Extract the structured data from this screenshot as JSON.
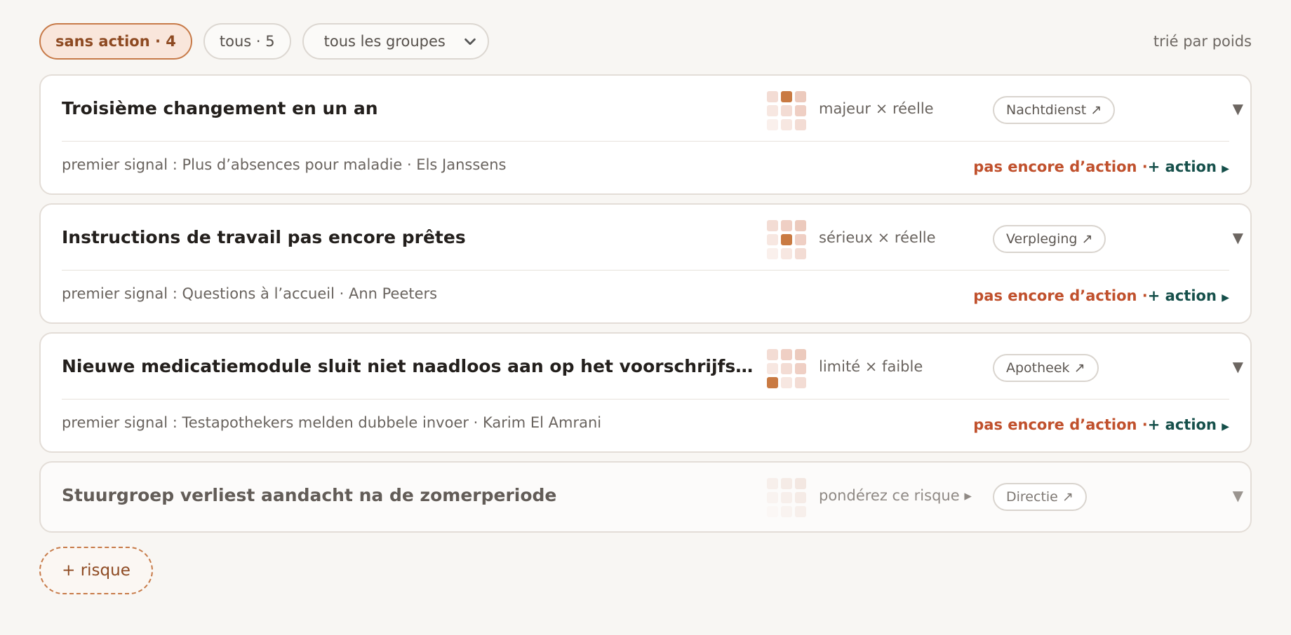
{
  "toolbar": {
    "filter_no_action": "sans action · 4",
    "filter_all": "tous · 5",
    "group_select": "tous les groupes",
    "sort_label": "trié par poids"
  },
  "colors": {
    "accent": "#c77a48",
    "no_action": "#c0502c",
    "add_action": "#154f4a",
    "matrix_active": "#c97a42"
  },
  "risks": [
    {
      "title": "Troisième changement en un an",
      "severity": "majeur × réelle",
      "group": "Nachtdienst ↗",
      "matrix_active": {
        "row": 1,
        "col": 2
      },
      "signal": "premier signal : Plus d’absences pour maladie · Els Janssens",
      "status": "pas encore d’action ·",
      "add_action": "+ action",
      "expand_icon": "▼"
    },
    {
      "title": "Instructions de travail pas encore prêtes",
      "severity": "sérieux × réelle",
      "group": "Verpleging ↗",
      "matrix_active": {
        "row": 2,
        "col": 2
      },
      "signal": "premier signal : Questions à l’accueil · Ann Peeters",
      "status": "pas encore d’action ·",
      "add_action": "+ action",
      "expand_icon": "▼"
    },
    {
      "title": "Nieuwe medicatiemodule sluit niet naadloos aan op het voorschrijfsysteem",
      "severity": "limité × faible",
      "group": "Apotheek ↗",
      "matrix_active": {
        "row": 3,
        "col": 1
      },
      "signal": "premier signal : Testapothekers melden dubbele invoer · Karim El Amrani",
      "status": "pas encore d’action ·",
      "add_action": "+ action",
      "expand_icon": "▼"
    },
    {
      "title": "Stuurgroep verliest aandacht na de zomerperiode",
      "severity": "pondérez ce risque ▸",
      "group": "Directie ↗",
      "expand_icon": "▼"
    }
  ],
  "add_risk": "+ risque"
}
